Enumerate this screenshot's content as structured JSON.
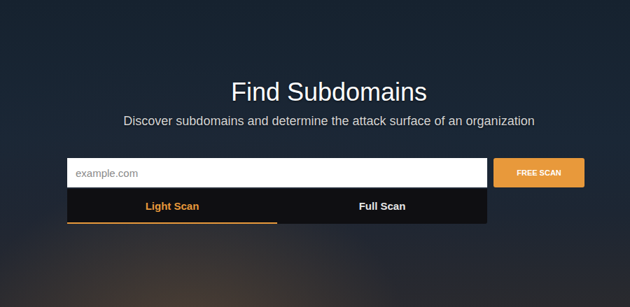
{
  "heading": {
    "title": "Find Subdomains",
    "subtitle": "Discover subdomains and determine the attack surface of an organization"
  },
  "search": {
    "placeholder": "example.com"
  },
  "buttons": [
    "FREE SCAN"
  ],
  "tabs": [
    {
      "label": "Light Scan",
      "selected": true
    },
    {
      "label": "Full Scan",
      "selected": false
    }
  ]
}
